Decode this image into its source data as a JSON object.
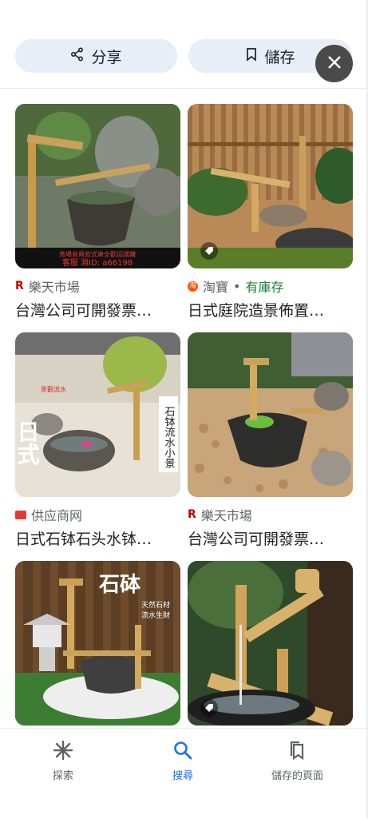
{
  "header": {
    "share_label": "分享",
    "save_label": "儲存"
  },
  "results": [
    {
      "source": "樂天市場",
      "source_icon": "rakuten-icon",
      "in_stock": "",
      "title": "台灣公司可開發票…",
      "overlay_text_1": "竟場音頁款式衆全歡迎選購",
      "overlay_text_2": "客服 淵ID: a66198"
    },
    {
      "source": "淘寶",
      "source_icon": "taobao-icon",
      "in_stock": "有庫存",
      "separator": "•",
      "title": "日式庭院造景佈置…"
    },
    {
      "source": "供应商网",
      "source_icon": "supplier-icon",
      "in_stock": "",
      "title": "日式石钵石头水钵…",
      "overlay_big": "日式",
      "overlay_small": "景觀流水",
      "overlay_vertical": "石钵流水小景"
    },
    {
      "source": "樂天市場",
      "source_icon": "rakuten-icon",
      "in_stock": "",
      "title": "台灣公司可開發票…"
    },
    {
      "source": "",
      "title": "",
      "overlay_big": "石砵",
      "overlay_small_1": "天然石材",
      "overlay_small_2": "流水生财"
    },
    {
      "source": "",
      "title": ""
    }
  ],
  "bottom_nav": {
    "explore_label": "探索",
    "search_label": "搜尋",
    "saved_label": "儲存的頁面"
  },
  "colors": {
    "pill_bg": "#e8eef7",
    "active_blue": "#1a73e8",
    "in_stock_green": "#188038"
  }
}
